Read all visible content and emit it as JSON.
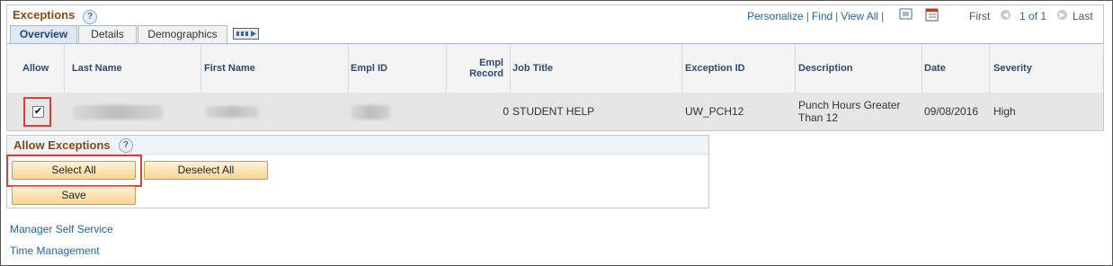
{
  "exceptions": {
    "title": "Exceptions",
    "help_glyph": "?",
    "toolbar": {
      "personalize": "Personalize",
      "find": "Find",
      "view_all": "View All",
      "first": "First",
      "range": "1 of 1",
      "last": "Last"
    },
    "tabs": [
      "Overview",
      "Details",
      "Demographics"
    ],
    "columns": {
      "allow": "Allow",
      "last_name": "Last Name",
      "first_name": "First Name",
      "empl_id": "Empl ID",
      "empl_record_1": "Empl",
      "empl_record_2": "Record",
      "job_title": "Job Title",
      "exception_id": "Exception ID",
      "description": "Description",
      "date": "Date",
      "severity": "Severity"
    },
    "row": {
      "allow_checked": "✔",
      "empl_record": "0",
      "job_title": "STUDENT HELP",
      "exception_id": "UW_PCH12",
      "description_1": "Punch Hours Greater",
      "description_2": "Than 12",
      "date": "09/08/2016",
      "severity": "High"
    }
  },
  "allow_exceptions": {
    "title": "Allow Exceptions",
    "help_glyph": "?",
    "select_all": "Select All",
    "deselect_all": "Deselect All",
    "save": "Save"
  },
  "links": {
    "manager_self_service": "Manager Self Service",
    "time_management": "Time Management"
  },
  "colors": {
    "title": "#8a4a14",
    "link": "#2463a8",
    "highlight": "#d9403a",
    "button": "#f9d793"
  }
}
